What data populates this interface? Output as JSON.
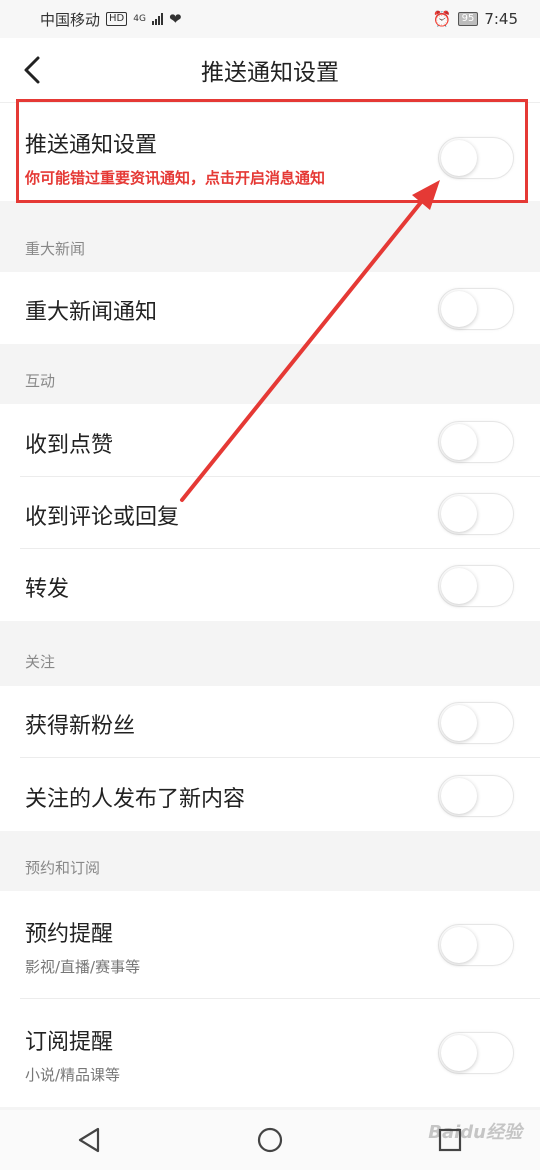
{
  "status_bar": {
    "carrier": "中国移动",
    "hd": "HD",
    "network": "4G",
    "battery": "95",
    "time": "7:45"
  },
  "header": {
    "title": "推送通知设置"
  },
  "push": {
    "label": "推送通知设置",
    "desc": "你可能错过重要资讯通知，点击开启消息通知"
  },
  "sections": {
    "major_news": "重大新闻",
    "interaction": "互动",
    "follow": "关注",
    "booking": "预约和订阅"
  },
  "items": {
    "major_news_notice": "重大新闻通知",
    "likes": "收到点赞",
    "comments": "收到评论或回复",
    "forward": "转发",
    "new_fans": "获得新粉丝",
    "follow_new": "关注的人发布了新内容",
    "booking_remind": "预约提醒",
    "booking_desc": "影视/直播/赛事等",
    "subscribe_remind": "订阅提醒",
    "subscribe_desc": "小说/精品课等"
  },
  "watermark": "Baidu经验",
  "colors": {
    "accent_red": "#e53935",
    "toggle_off": "#ffffff"
  }
}
